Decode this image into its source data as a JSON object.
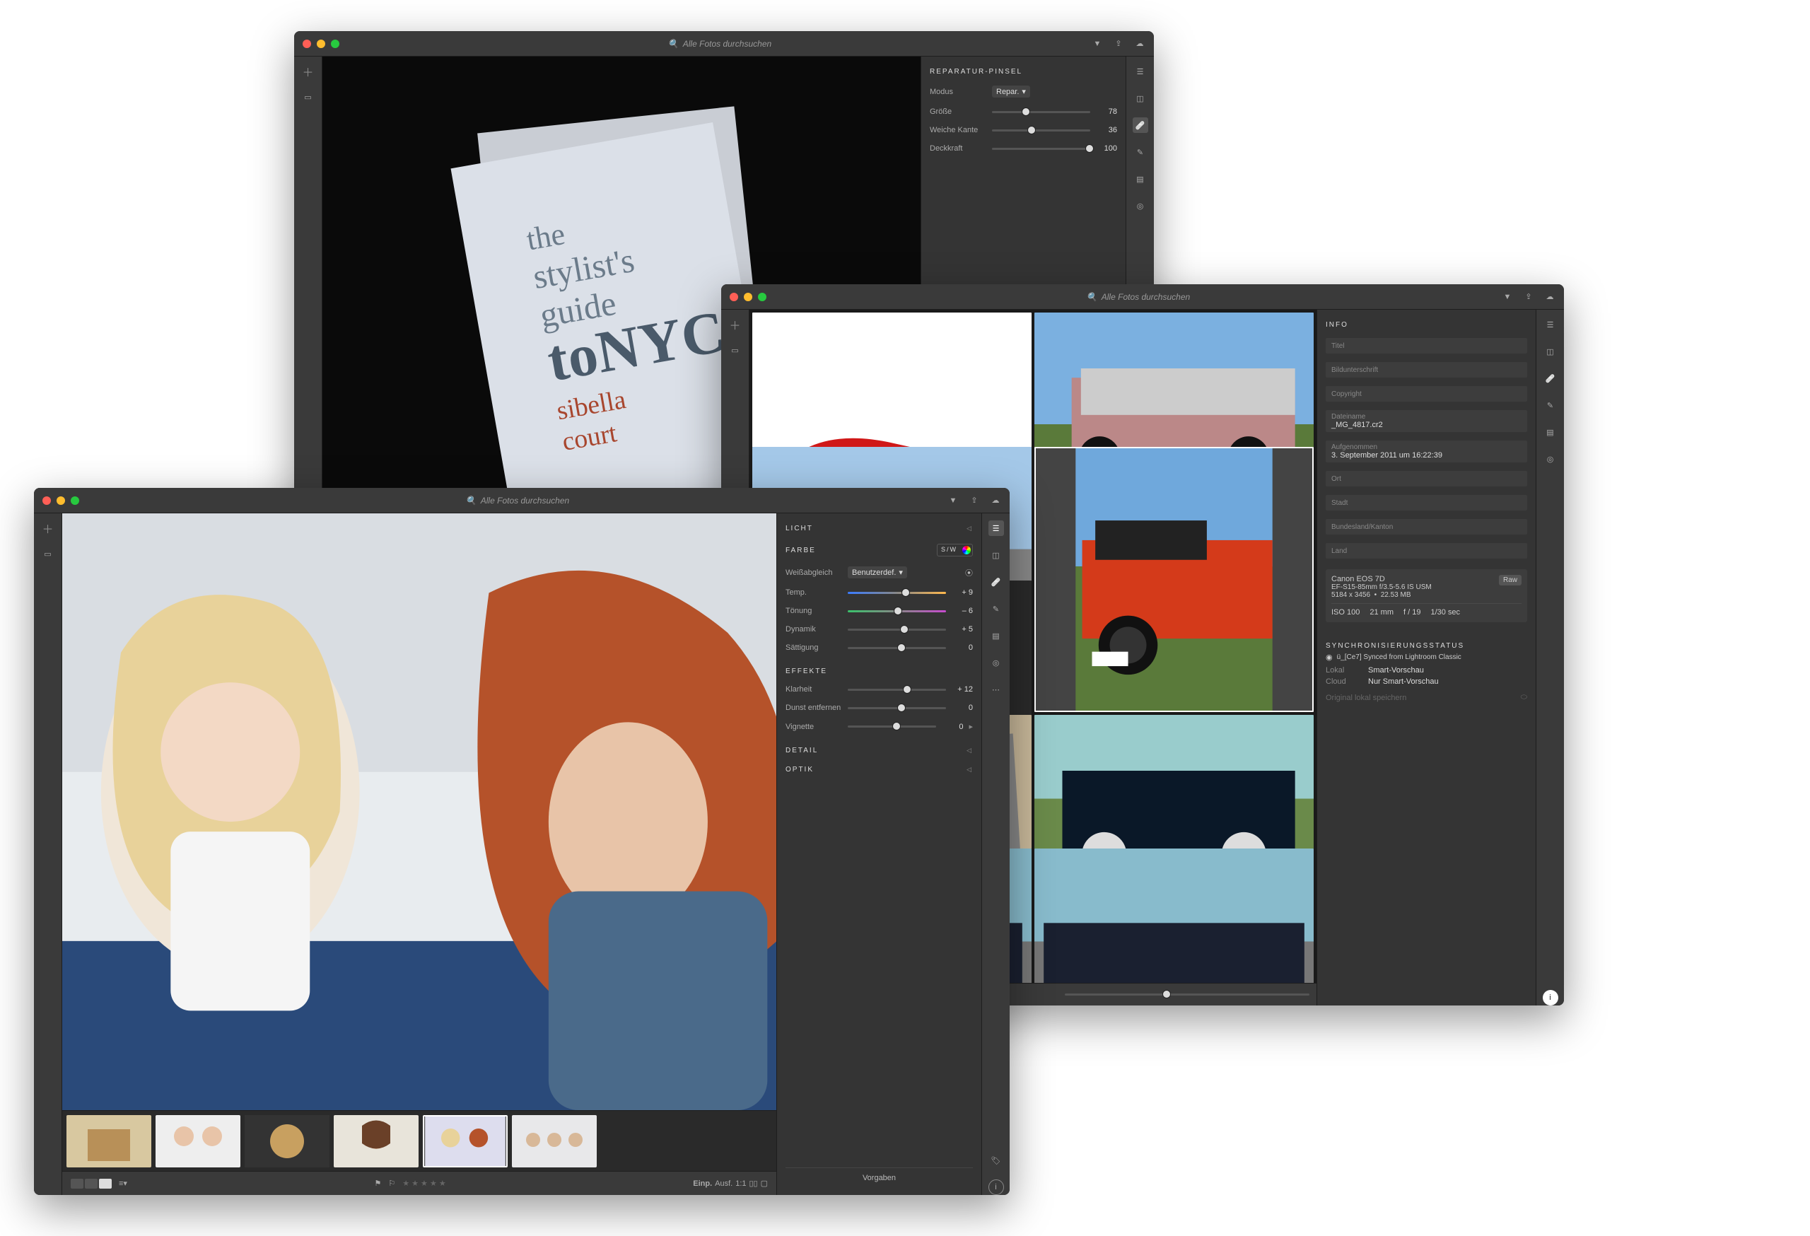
{
  "search_placeholder": "Alle Fotos durchsuchen",
  "window1": {
    "panel_title": "REPARATUR-PINSEL",
    "mode_label": "Modus",
    "mode_value": "Repar.",
    "size_label": "Größe",
    "size_value": "78",
    "feather_label": "Weiche Kante",
    "feather_value": "36",
    "opacity_label": "Deckkraft",
    "opacity_value": "100"
  },
  "window2": {
    "panel_title": "INFO",
    "fields": {
      "title": "Titel",
      "caption": "Bildunterschrift",
      "copyright": "Copyright",
      "filename_label": "Dateiname",
      "filename_value": "_MG_4817.cr2",
      "taken_label": "Aufgenommen",
      "taken_value": "3. September 2011 um 16:22:39",
      "location": "Ort",
      "city": "Stadt",
      "state": "Bundesland/Kanton",
      "country": "Land"
    },
    "camera": {
      "model": "Canon EOS 7D",
      "lens": "EF-S15-85mm f/3.5-5.6 IS USM",
      "dims": "5184 x 3456",
      "size": "22.53 MB",
      "badge": "Raw",
      "iso": "ISO 100",
      "focal": "21 mm",
      "aperture": "f / 19",
      "shutter": "1/30 sec"
    },
    "sync": {
      "title": "SYNCHRONISIERUNGSSTATUS",
      "status": "ü_[Ce7] Synced from Lightroom Classic",
      "local_label": "Lokal",
      "local_value": "Smart-Vorschau",
      "cloud_label": "Cloud",
      "cloud_value": "Nur Smart-Vorschau",
      "store_label": "Original lokal speichern"
    }
  },
  "window3": {
    "light": "LICHT",
    "color": "FARBE",
    "sw": "S/W",
    "wb_label": "Weißabgleich",
    "wb_value": "Benutzerdef.",
    "temp_label": "Temp.",
    "temp_value": "+ 9",
    "tint_label": "Tönung",
    "tint_value": "– 6",
    "vibrance_label": "Dynamik",
    "vibrance_value": "+ 5",
    "saturation_label": "Sättigung",
    "saturation_value": "0",
    "effects": "EFFEKTE",
    "clarity_label": "Klarheit",
    "clarity_value": "+ 12",
    "dehaze_label": "Dunst entfernen",
    "dehaze_value": "0",
    "vignette_label": "Vignette",
    "vignette_value": "0",
    "detail": "DETAIL",
    "optics": "OPTIK",
    "presets": "Vorgaben",
    "fit": "Einp.",
    "fill": "Ausf.",
    "oneone": "1:1"
  }
}
